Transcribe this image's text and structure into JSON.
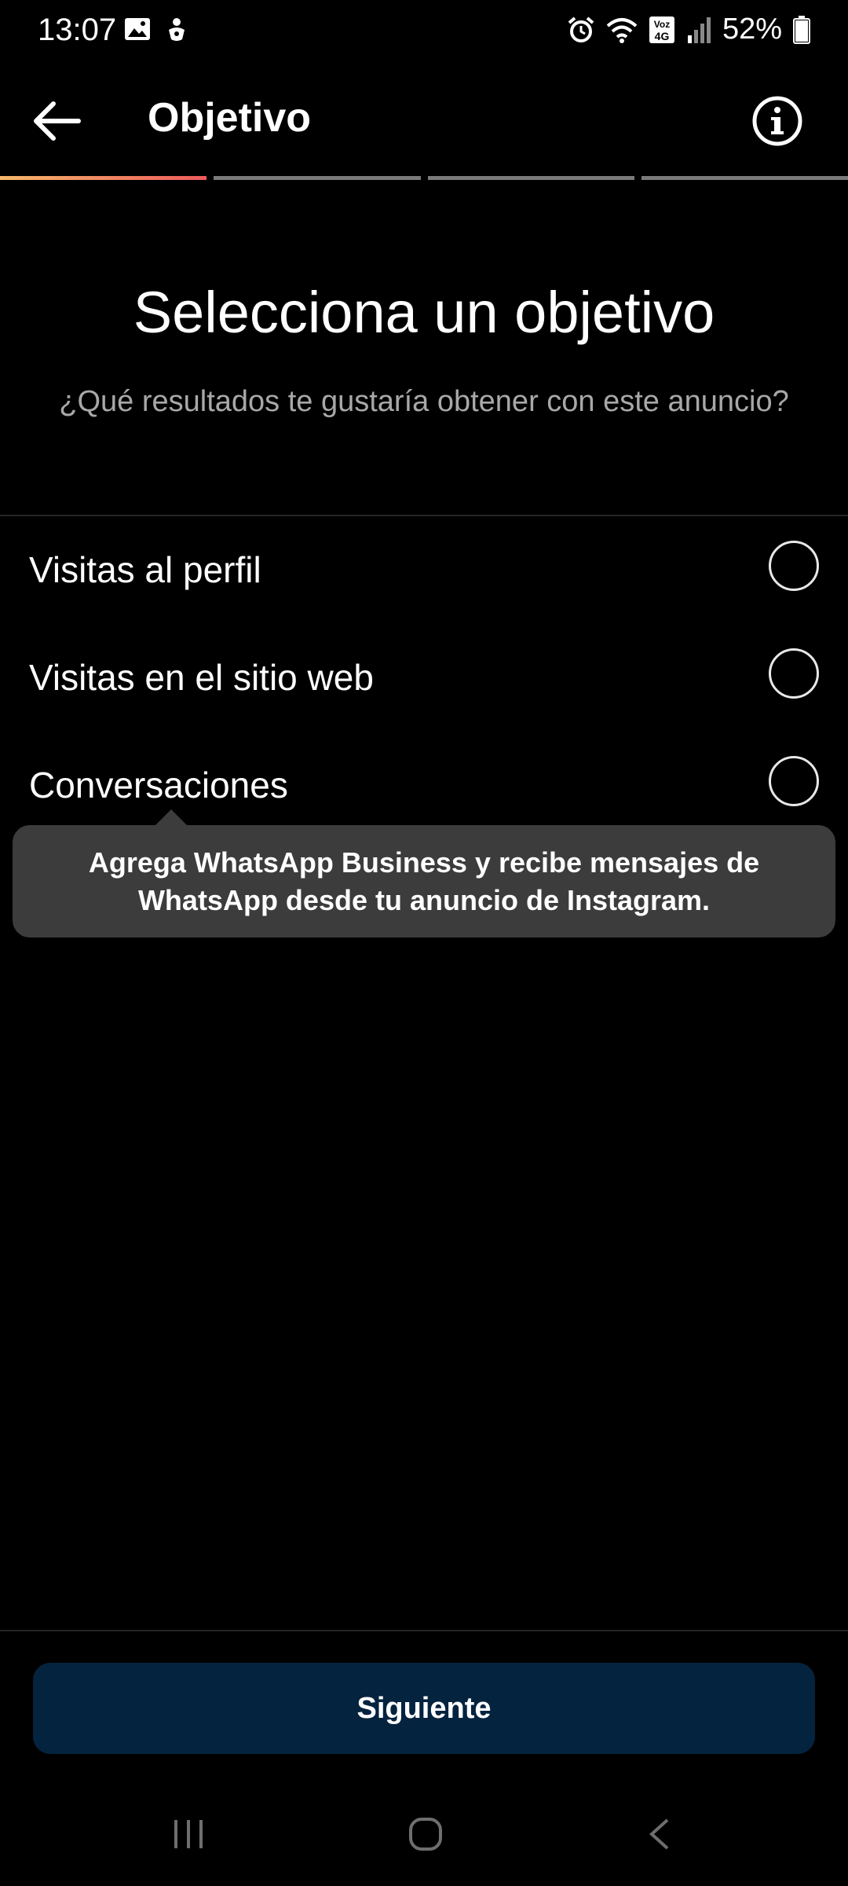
{
  "status_bar": {
    "time": "13:07",
    "battery": "52%",
    "network": "Voz 4G"
  },
  "header": {
    "title": "Objetivo"
  },
  "progress": {
    "steps_total": 4,
    "current_step": 1
  },
  "main": {
    "heading": "Selecciona un objetivo",
    "subheading": "¿Qué resultados te gustaría obtener con este anuncio?",
    "options": [
      {
        "label": "Visitas al perfil",
        "selected": false
      },
      {
        "label": "Visitas en el sitio web",
        "selected": false
      },
      {
        "label": "Conversaciones",
        "selected": false
      }
    ],
    "tooltip": "Agrega WhatsApp Business y recibe mensajes de WhatsApp desde tu anuncio de Instagram."
  },
  "footer": {
    "next_label": "Siguiente"
  },
  "colors": {
    "background": "#000000",
    "button": "#04233f",
    "tooltip": "#3c3c3c",
    "progress_active_start": "#f5b86b",
    "progress_active_end": "#ee5a5a"
  }
}
